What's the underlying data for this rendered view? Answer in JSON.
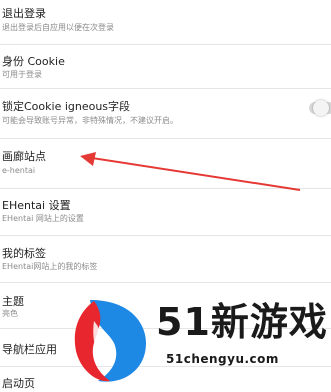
{
  "settings": [
    {
      "title": "退出登录",
      "subtitle": "退出登录后自应用以便在次登录"
    },
    {
      "title": "身份 Cookie",
      "subtitle": "可用于登录"
    },
    {
      "title": "锁定Cookie igneous字段",
      "subtitle": "可能会导致账号异常，非特殊情况，不建议开启。",
      "toggle_on": false
    },
    {
      "title": "画廊站点",
      "subtitle": "e-hentai"
    },
    {
      "title": "EHentai 设置",
      "subtitle": "EHentai 网站上的设置"
    },
    {
      "title": "我的标签",
      "subtitle": "EHentai网站上的我的标签"
    },
    {
      "title": "主题",
      "subtitle": "亮色"
    },
    {
      "title": "导航栏应用",
      "subtitle": ""
    },
    {
      "title": "启动页",
      "subtitle": ""
    }
  ],
  "watermark": {
    "brand": "51新游戏",
    "url": "51chengyu.com",
    "colors": {
      "red": "#e8262d",
      "blue": "#1e88e5",
      "text": "#1a1a1a"
    }
  },
  "arrow": {
    "color": "#e53935"
  }
}
